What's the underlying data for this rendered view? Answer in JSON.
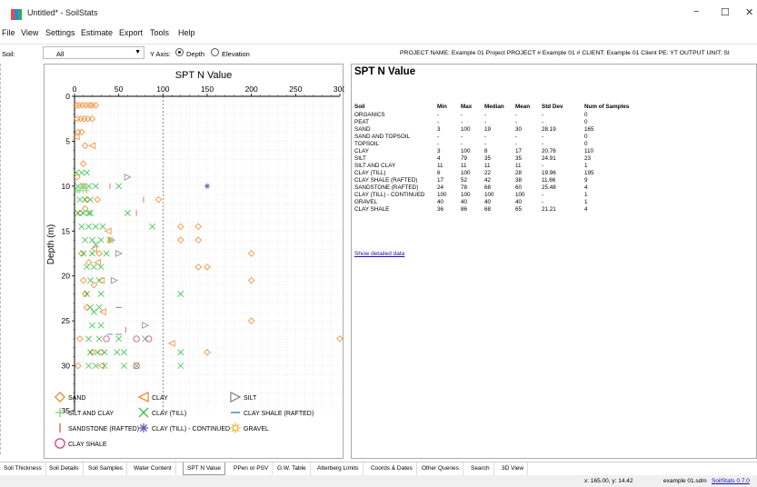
{
  "window": {
    "title": "Untitled* - SoilStats",
    "minimize": "−",
    "maximize": "☐",
    "close": "✕"
  },
  "menu": [
    "File",
    "View",
    "Settings",
    "Estimate",
    "Export",
    "Tools",
    "Help"
  ],
  "toolbar": {
    "soil_label": "Soil:",
    "soil_value": "All",
    "yaxis_label": "Y Axis:",
    "depth_label": "Depth",
    "elevation_label": "Elevation",
    "yaxis_selected": "Depth",
    "project_info": "PROJECT NAME: Example 01 Project   PROJECT # Example 01 #   CLIENT: Example 01 Client   PE: YT   OUTPUT UNIT: SI"
  },
  "chart_data": {
    "type": "scatter",
    "title": "SPT N Value",
    "xlabel": "",
    "ylabel": "Depth (m)",
    "xlim": [
      0,
      300
    ],
    "ylim": [
      0,
      35
    ],
    "y_inverted": true,
    "x_axis_position": "top",
    "x_ticks": [
      "0",
      "50",
      "100",
      "150",
      "200",
      "250",
      "300"
    ],
    "y_ticks": [
      "0",
      "5",
      "10",
      "15",
      "20",
      "25",
      "30",
      "35"
    ],
    "grid": true,
    "legend_position": "bottom",
    "series": [
      {
        "name": "SAND",
        "color": "#f28a2e",
        "marker": "diamond",
        "points": [
          [
            2,
            1
          ],
          [
            5,
            1
          ],
          [
            9,
            1
          ],
          [
            13,
            1
          ],
          [
            17,
            1
          ],
          [
            20,
            1
          ],
          [
            3,
            2.5
          ],
          [
            7,
            2.5
          ],
          [
            11,
            2.5
          ],
          [
            15,
            2.5
          ],
          [
            4,
            4
          ],
          [
            8,
            4
          ],
          [
            10,
            7.5
          ],
          [
            3,
            9
          ],
          [
            14,
            11.5
          ],
          [
            12,
            12.5
          ],
          [
            120,
            14.5
          ],
          [
            140,
            14.5
          ],
          [
            120,
            16
          ],
          [
            140,
            16
          ],
          [
            8,
            17.5
          ],
          [
            200,
            17.5
          ],
          [
            16,
            18.5
          ],
          [
            150,
            19
          ],
          [
            10,
            20.5
          ],
          [
            200,
            20.5
          ],
          [
            12,
            22
          ],
          [
            14,
            23.5
          ],
          [
            200,
            25
          ],
          [
            6,
            27
          ],
          [
            20,
            28.5
          ],
          [
            30,
            28.5
          ],
          [
            150,
            28.5
          ],
          [
            4,
            30
          ],
          [
            300,
            27
          ],
          [
            20,
            2.5
          ],
          [
            24,
            1
          ],
          [
            12,
            5.5
          ],
          [
            10,
            10
          ],
          [
            6,
            13
          ],
          [
            26,
            11.5
          ],
          [
            95,
            11.5
          ],
          [
            140,
            19
          ],
          [
            22,
            21
          ],
          [
            28,
            17.5
          ]
        ]
      },
      {
        "name": "CLAY",
        "color": "#f28a2e",
        "marker": "triangle-left",
        "points": [
          [
            2,
            4.5
          ],
          [
            20,
            5.5
          ],
          [
            22,
            17
          ],
          [
            26,
            18.5
          ],
          [
            30,
            20.5
          ],
          [
            32,
            24
          ],
          [
            38,
            15
          ],
          [
            110,
            27.5
          ],
          [
            30,
            30
          ]
        ]
      },
      {
        "name": "SILT",
        "color": "#888888",
        "marker": "triangle-right",
        "points": [
          [
            60,
            9
          ],
          [
            50,
            17.5
          ],
          [
            80,
            25.5
          ],
          [
            42,
            16
          ],
          [
            45,
            20.5
          ]
        ]
      },
      {
        "name": "SILT AND CLAY",
        "color": "#7ad36b",
        "marker": "plus",
        "points": [
          [
            2,
            10.5
          ],
          [
            4,
            10.5
          ],
          [
            6,
            10.5
          ],
          [
            10,
            10.5
          ],
          [
            14,
            10.5
          ]
        ]
      },
      {
        "name": "CLAY (TILL)",
        "color": "#3cc24a",
        "marker": "x",
        "points": [
          [
            2,
            8.5
          ],
          [
            8,
            8.5
          ],
          [
            14,
            8.5
          ],
          [
            4,
            10
          ],
          [
            10,
            10
          ],
          [
            16,
            10
          ],
          [
            24,
            10
          ],
          [
            50,
            10
          ],
          [
            6,
            11.5
          ],
          [
            12,
            11.5
          ],
          [
            18,
            11.5
          ],
          [
            4,
            13
          ],
          [
            10,
            13
          ],
          [
            16,
            13
          ],
          [
            60,
            13
          ],
          [
            8,
            14.5
          ],
          [
            16,
            14.5
          ],
          [
            24,
            14.5
          ],
          [
            32,
            14.5
          ],
          [
            88,
            14.5
          ],
          [
            12,
            16
          ],
          [
            20,
            16
          ],
          [
            30,
            16
          ],
          [
            40,
            16
          ],
          [
            10,
            17.5
          ],
          [
            20,
            17.5
          ],
          [
            36,
            17.5
          ],
          [
            14,
            19
          ],
          [
            22,
            19
          ],
          [
            30,
            19
          ],
          [
            18,
            20.5
          ],
          [
            28,
            20.5
          ],
          [
            14,
            22
          ],
          [
            30,
            22
          ],
          [
            120,
            22
          ],
          [
            18,
            23.5
          ],
          [
            28,
            23.5
          ],
          [
            20,
            25.5
          ],
          [
            30,
            25.5
          ],
          [
            16,
            27
          ],
          [
            28,
            27
          ],
          [
            50,
            27
          ],
          [
            80,
            27
          ],
          [
            18,
            28.5
          ],
          [
            26,
            28.5
          ],
          [
            34,
            28.5
          ],
          [
            48,
            28.5
          ],
          [
            56,
            28.5
          ],
          [
            120,
            28.5
          ],
          [
            16,
            30
          ],
          [
            24,
            30
          ],
          [
            34,
            30
          ],
          [
            56,
            30
          ],
          [
            70,
            30
          ],
          [
            120,
            30
          ],
          [
            22,
            24
          ],
          [
            24,
            16.5
          ],
          [
            18,
            13
          ]
        ]
      },
      {
        "name": "CLAY SHALE (RAFTED)",
        "color": "#3a6fb5",
        "marker": "hline",
        "points": [
          [
            50,
            23.5
          ],
          [
            40,
            26.5
          ],
          [
            50,
            26.5
          ]
        ]
      },
      {
        "name": "SANDSTONE (RAFTED)",
        "color": "#e0524f",
        "marker": "vline",
        "points": [
          [
            40,
            10
          ],
          [
            78,
            11.5
          ],
          [
            70,
            13
          ],
          [
            58,
            26
          ]
        ]
      },
      {
        "name": "CLAY (TILL) - CONTINUED",
        "color": "#6a5ab8",
        "marker": "asterisk",
        "points": [
          [
            150,
            10
          ]
        ]
      },
      {
        "name": "GRAVEL",
        "color": "#f2b632",
        "marker": "sun",
        "points": [
          [
            40,
            16
          ]
        ]
      },
      {
        "name": "CLAY SHALE",
        "color": "#d8417a",
        "marker": "circle",
        "points": [
          [
            70,
            27
          ],
          [
            84,
            27
          ],
          [
            36,
            27
          ],
          [
            70,
            30
          ]
        ]
      }
    ]
  },
  "stats": {
    "title": "SPT N Value",
    "headers": [
      "Soil",
      "Min",
      "Max",
      "Median",
      "Mean",
      "Std Dev",
      "Num of Samples"
    ],
    "rows": [
      [
        "ORGANICS",
        "-",
        "-",
        "-",
        "-",
        "-",
        "0"
      ],
      [
        "PEAT",
        "-",
        "-",
        "-",
        "-",
        "-",
        "0"
      ],
      [
        "SAND",
        "3",
        "100",
        "19",
        "30",
        "28.19",
        "165"
      ],
      [
        "SAND AND TOPSOIL",
        "-",
        "-",
        "-",
        "-",
        "-",
        "0"
      ],
      [
        "TOPSOIL",
        "-",
        "-",
        "-",
        "-",
        "-",
        "0"
      ],
      [
        "CLAY",
        "3",
        "100",
        "8",
        "17",
        "20.76",
        "110"
      ],
      [
        "SILT",
        "4",
        "79",
        "35",
        "35",
        "24.91",
        "23"
      ],
      [
        "SILT AND CLAY",
        "11",
        "11",
        "11",
        "11",
        "-",
        "1"
      ],
      [
        "CLAY (TILL)",
        "6",
        "100",
        "22",
        "28",
        "19.96",
        "195"
      ],
      [
        "CLAY SHALE (RAFTED)",
        "17",
        "52",
        "42",
        "38",
        "11.66",
        "9"
      ],
      [
        "SANDSTONE (RAFTED)",
        "24",
        "78",
        "68",
        "60",
        "25.48",
        "4"
      ],
      [
        "CLAY (TILL) - CONTINUED",
        "100",
        "100",
        "100",
        "100",
        "-",
        "1"
      ],
      [
        "GRAVEL",
        "40",
        "40",
        "40",
        "40",
        "-",
        "1"
      ],
      [
        "CLAY SHALE",
        "36",
        "86",
        "68",
        "65",
        "21.21",
        "4"
      ]
    ],
    "show_detailed": "Show detailed data"
  },
  "tabs": [
    "Soil Thickness",
    "Soil Details",
    "Soil Samples",
    "Water Content",
    "SPT N Value",
    "PPen or PSV",
    "G.W. Table",
    "Atterberg Limits",
    "Coords & Dates",
    "Other Queries",
    "Search",
    "3D View"
  ],
  "active_tab": "SPT N Value",
  "status": {
    "coords": "x: 165.00, y: 14.42",
    "file": "example 01.sdm",
    "version": "SoilStats 0.7.0"
  }
}
